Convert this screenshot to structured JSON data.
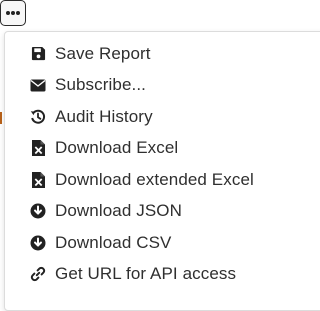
{
  "menu": {
    "items": [
      {
        "label": "Save Report",
        "icon": "save-icon"
      },
      {
        "label": "Subscribe...",
        "icon": "envelope-icon"
      },
      {
        "label": "Audit History",
        "icon": "history-icon"
      },
      {
        "label": "Download Excel",
        "icon": "file-excel-icon"
      },
      {
        "label": "Download extended Excel",
        "icon": "file-excel-icon"
      },
      {
        "label": "Download JSON",
        "icon": "download-circle-icon"
      },
      {
        "label": "Download CSV",
        "icon": "download-circle-icon"
      },
      {
        "label": "Get URL for API access",
        "icon": "link-icon"
      }
    ]
  },
  "colors": {
    "icon": "#222222",
    "text": "#2f2f2f",
    "border": "#dcdcdc",
    "edge_accent": "#b9621a"
  }
}
